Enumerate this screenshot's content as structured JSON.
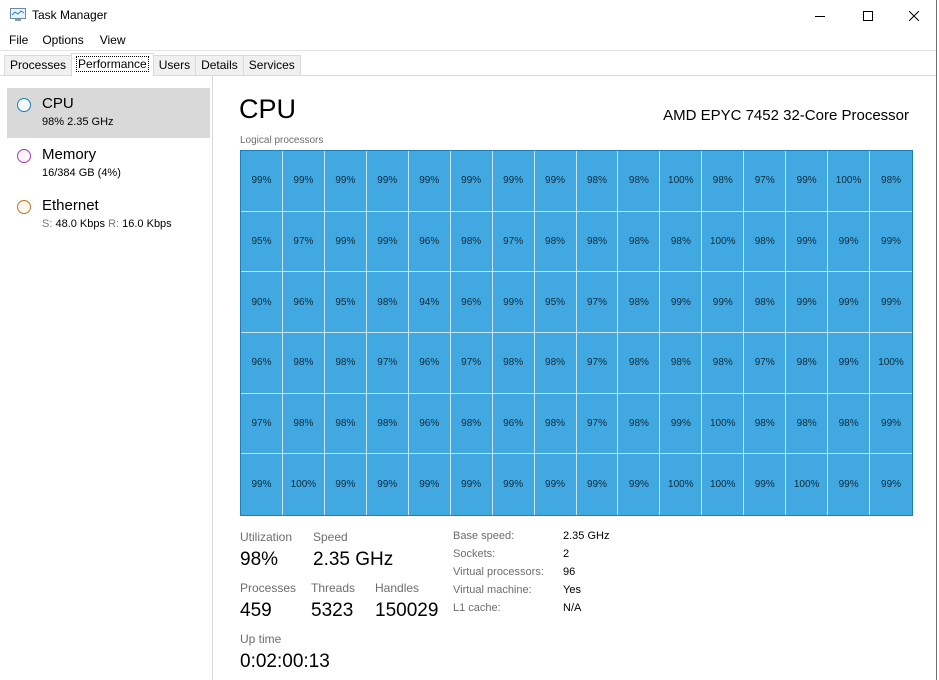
{
  "window": {
    "title": "Task Manager",
    "icon": "task-manager-icon",
    "controls": [
      "minimize-icon",
      "maximize-icon",
      "close-icon"
    ]
  },
  "menu": [
    "File",
    "Options",
    "View"
  ],
  "tabs": [
    {
      "label": "Processes",
      "active": false
    },
    {
      "label": "Performance",
      "active": true
    },
    {
      "label": "Users",
      "active": false
    },
    {
      "label": "Details",
      "active": false
    },
    {
      "label": "Services",
      "active": false
    }
  ],
  "sidebar": {
    "items": [
      {
        "name": "CPU",
        "detail": "98% 2.35 GHz",
        "color": "#1c7fbc",
        "selected": true
      },
      {
        "name": "Memory",
        "detail": "16/384 GB (4%)",
        "color": "#a03db5",
        "selected": false
      },
      {
        "name": "Ethernet",
        "send_label": "S:",
        "send_value": "48.0 Kbps",
        "recv_label": "R:",
        "recv_value": "16.0 Kbps",
        "color": "#c4731f",
        "selected": false
      }
    ]
  },
  "main": {
    "title": "CPU",
    "processor": "AMD EPYC 7452 32-Core Processor",
    "grid_label": "Logical processors",
    "grid_color": "#41a8e1",
    "logical_processors": [
      [
        99,
        99,
        99,
        99,
        99,
        99,
        99,
        99,
        98,
        98,
        100,
        98,
        97,
        99,
        100,
        98
      ],
      [
        95,
        97,
        99,
        99,
        96,
        98,
        97,
        98,
        98,
        98,
        98,
        100,
        98,
        99,
        99,
        99
      ],
      [
        90,
        96,
        95,
        98,
        94,
        96,
        99,
        95,
        97,
        98,
        99,
        99,
        98,
        99,
        99,
        99
      ],
      [
        96,
        98,
        98,
        97,
        96,
        97,
        98,
        98,
        97,
        98,
        98,
        98,
        97,
        98,
        99,
        100
      ],
      [
        97,
        98,
        98,
        98,
        96,
        98,
        96,
        98,
        97,
        98,
        99,
        100,
        98,
        98,
        98,
        99
      ],
      [
        99,
        100,
        99,
        99,
        99,
        99,
        99,
        99,
        99,
        99,
        100,
        100,
        99,
        100,
        99,
        99
      ]
    ],
    "stats": {
      "utilization_label": "Utilization",
      "utilization": "98%",
      "speed_label": "Speed",
      "speed": "2.35 GHz",
      "processes_label": "Processes",
      "processes": "459",
      "threads_label": "Threads",
      "threads": "5323",
      "handles_label": "Handles",
      "handles": "150029",
      "uptime_label": "Up time",
      "uptime": "0:02:00:13"
    },
    "details": [
      {
        "label": "Base speed:",
        "value": "2.35 GHz"
      },
      {
        "label": "Sockets:",
        "value": "2"
      },
      {
        "label": "Virtual processors:",
        "value": "96"
      },
      {
        "label": "Virtual machine:",
        "value": "Yes"
      },
      {
        "label": "L1 cache:",
        "value": "N/A"
      }
    ]
  }
}
